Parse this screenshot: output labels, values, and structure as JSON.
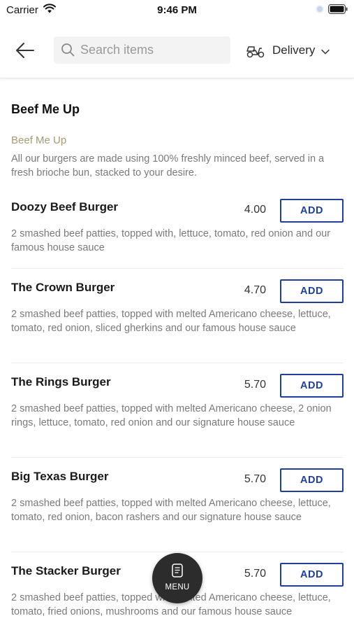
{
  "status_bar": {
    "carrier": "Carrier",
    "time": "9:46 PM"
  },
  "header": {
    "search_placeholder": "Search items",
    "delivery_label": "Delivery"
  },
  "category": {
    "title": "Beef Me Up",
    "subtitle": "Beef Me Up",
    "description": "All our burgers are made using 100% freshly minced beef, served in a fresh brioche bun, stacked to your desire."
  },
  "add_label": "ADD",
  "items": [
    {
      "name": "Doozy Beef Burger",
      "price": "4.00",
      "description": "2 smashed beef patties, topped with, lettuce, tomato, red onion and our famous house sauce"
    },
    {
      "name": "The Crown Burger",
      "price": "4.70",
      "description": "2 smashed beef patties, topped with melted Americano cheese, lettuce, tomato, red onion, sliced gherkins and our famous house sauce"
    },
    {
      "name": "The Rings Burger",
      "price": "5.70",
      "description": "2 smashed beef patties, topped with melted Americano cheese, 2 onion rings, lettuce, tomato, red onion and our signature house sauce"
    },
    {
      "name": "Big Texas Burger",
      "price": "5.70",
      "description": "2 smashed beef patties, topped with melted Americano cheese, lettuce, tomato, red onion, bacon rashers and our signature house sauce"
    },
    {
      "name": "The Stacker Burger",
      "price": "5.70",
      "description": "2 smashed beef patties, topped with melted Americano cheese, lettuce, tomato, fried onions, mushrooms and our famous house sauce"
    }
  ],
  "menu_fab": {
    "label": "MENU",
    "icon": "menu-card-icon"
  },
  "icons": {
    "back": "arrow-left-icon",
    "search": "search-icon",
    "delivery": "scooter-icon",
    "dropdown": "chevron-down-icon",
    "wifi": "wifi-icon",
    "battery": "battery-icon",
    "location": "location-icon"
  },
  "colors": {
    "accent": "#1f3f9e",
    "subtitle": "#a69a74",
    "description": "#7a7a7a",
    "fab_background": "#2c2c2c"
  }
}
